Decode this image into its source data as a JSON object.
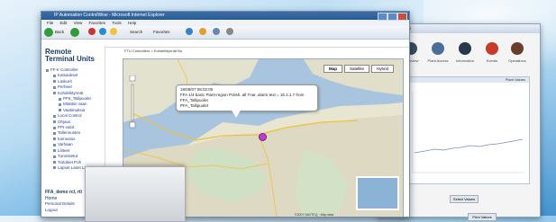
{
  "back_window": {
    "title": "s",
    "toolbar": [
      "Overview",
      "Plant Access",
      "Information",
      "Events",
      "Operations"
    ],
    "panel_header": "Plant Values",
    "buttons": [
      "Select Values",
      "Print Values"
    ]
  },
  "browser": {
    "title": "IP Automation ControlWise - Microsoft Internet Explorer",
    "menu": [
      "File",
      "Edit",
      "View",
      "Favorites",
      "Tools",
      "Help"
    ],
    "toolbar": {
      "back": "Back",
      "search": "Search",
      "favorites": "Favorites"
    }
  },
  "sidebar": {
    "title": "Remote Terminal Units",
    "items": [
      {
        "label": "FF-Ir Controller",
        "level": 1
      },
      {
        "label": "Katsaukset",
        "level": 2
      },
      {
        "label": "Laskurit",
        "level": 2
      },
      {
        "label": "Perheet",
        "level": 2
      },
      {
        "label": "Kohdeliitynnät",
        "level": 2
      },
      {
        "label": "PF6_Tallipuolet",
        "level": 3
      },
      {
        "label": "Mitattiin vaan",
        "level": 3
      },
      {
        "label": "Vaatimuksia",
        "level": 3
      },
      {
        "label": "Local Control",
        "level": 2
      },
      {
        "label": "Ohjaus",
        "level": 2
      },
      {
        "label": "PPI-valot",
        "level": 2
      },
      {
        "label": "Tallennusten",
        "level": 2
      },
      {
        "label": "tunnustus",
        "level": 2
      },
      {
        "label": "Varhaan",
        "level": 2
      },
      {
        "label": "Liitteet",
        "level": 2
      },
      {
        "label": "Tunnistetut",
        "level": 2
      },
      {
        "label": "Tiotokiet Poh",
        "level": 2
      },
      {
        "label": "Lapset Laset Lanth",
        "level": 2
      }
    ],
    "user": "FFA_demo  rcl, rtl",
    "user_sub": "Home",
    "links": [
      "Personal Details",
      "Logout"
    ]
  },
  "main": {
    "breadcrumb": "FTU Controllers > Kohdeliitynnät Nu",
    "tabs": [
      "Map",
      "Satellite",
      "Hybrid"
    ],
    "bubble_line1": "18/08/07 08:02:00",
    "bubble_line2": "FFA 1/4 basic Plant-region Polish. all Tnar. alarm text = 16.1.1.7 from FFA_Tallipuolet",
    "bubble_line3": "PFA_Tallipuolet",
    "copyright": "©2007 NAVTEQ · Map data"
  }
}
